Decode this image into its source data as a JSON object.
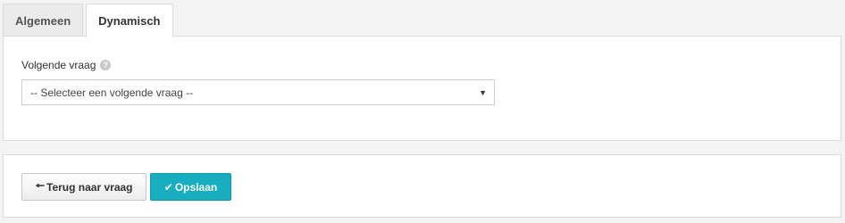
{
  "tabs": [
    {
      "label": "Algemeen",
      "active": false
    },
    {
      "label": "Dynamisch",
      "active": true
    }
  ],
  "form": {
    "next_question_label": "Volgende vraag",
    "help_glyph": "?",
    "next_question_select": {
      "selected": "-- Selecteer een volgende vraag --"
    }
  },
  "actions": {
    "back_label": "Terug naar vraag",
    "save_label": "Opslaan"
  },
  "icons": {
    "back": "arrow-left-icon",
    "save": "check-icon",
    "help": "question-circle-icon",
    "dropdown": "caret-down-icon"
  },
  "colors": {
    "accent": "#17aec0",
    "background": "#f3f3f3",
    "border": "#dcdcdc"
  }
}
